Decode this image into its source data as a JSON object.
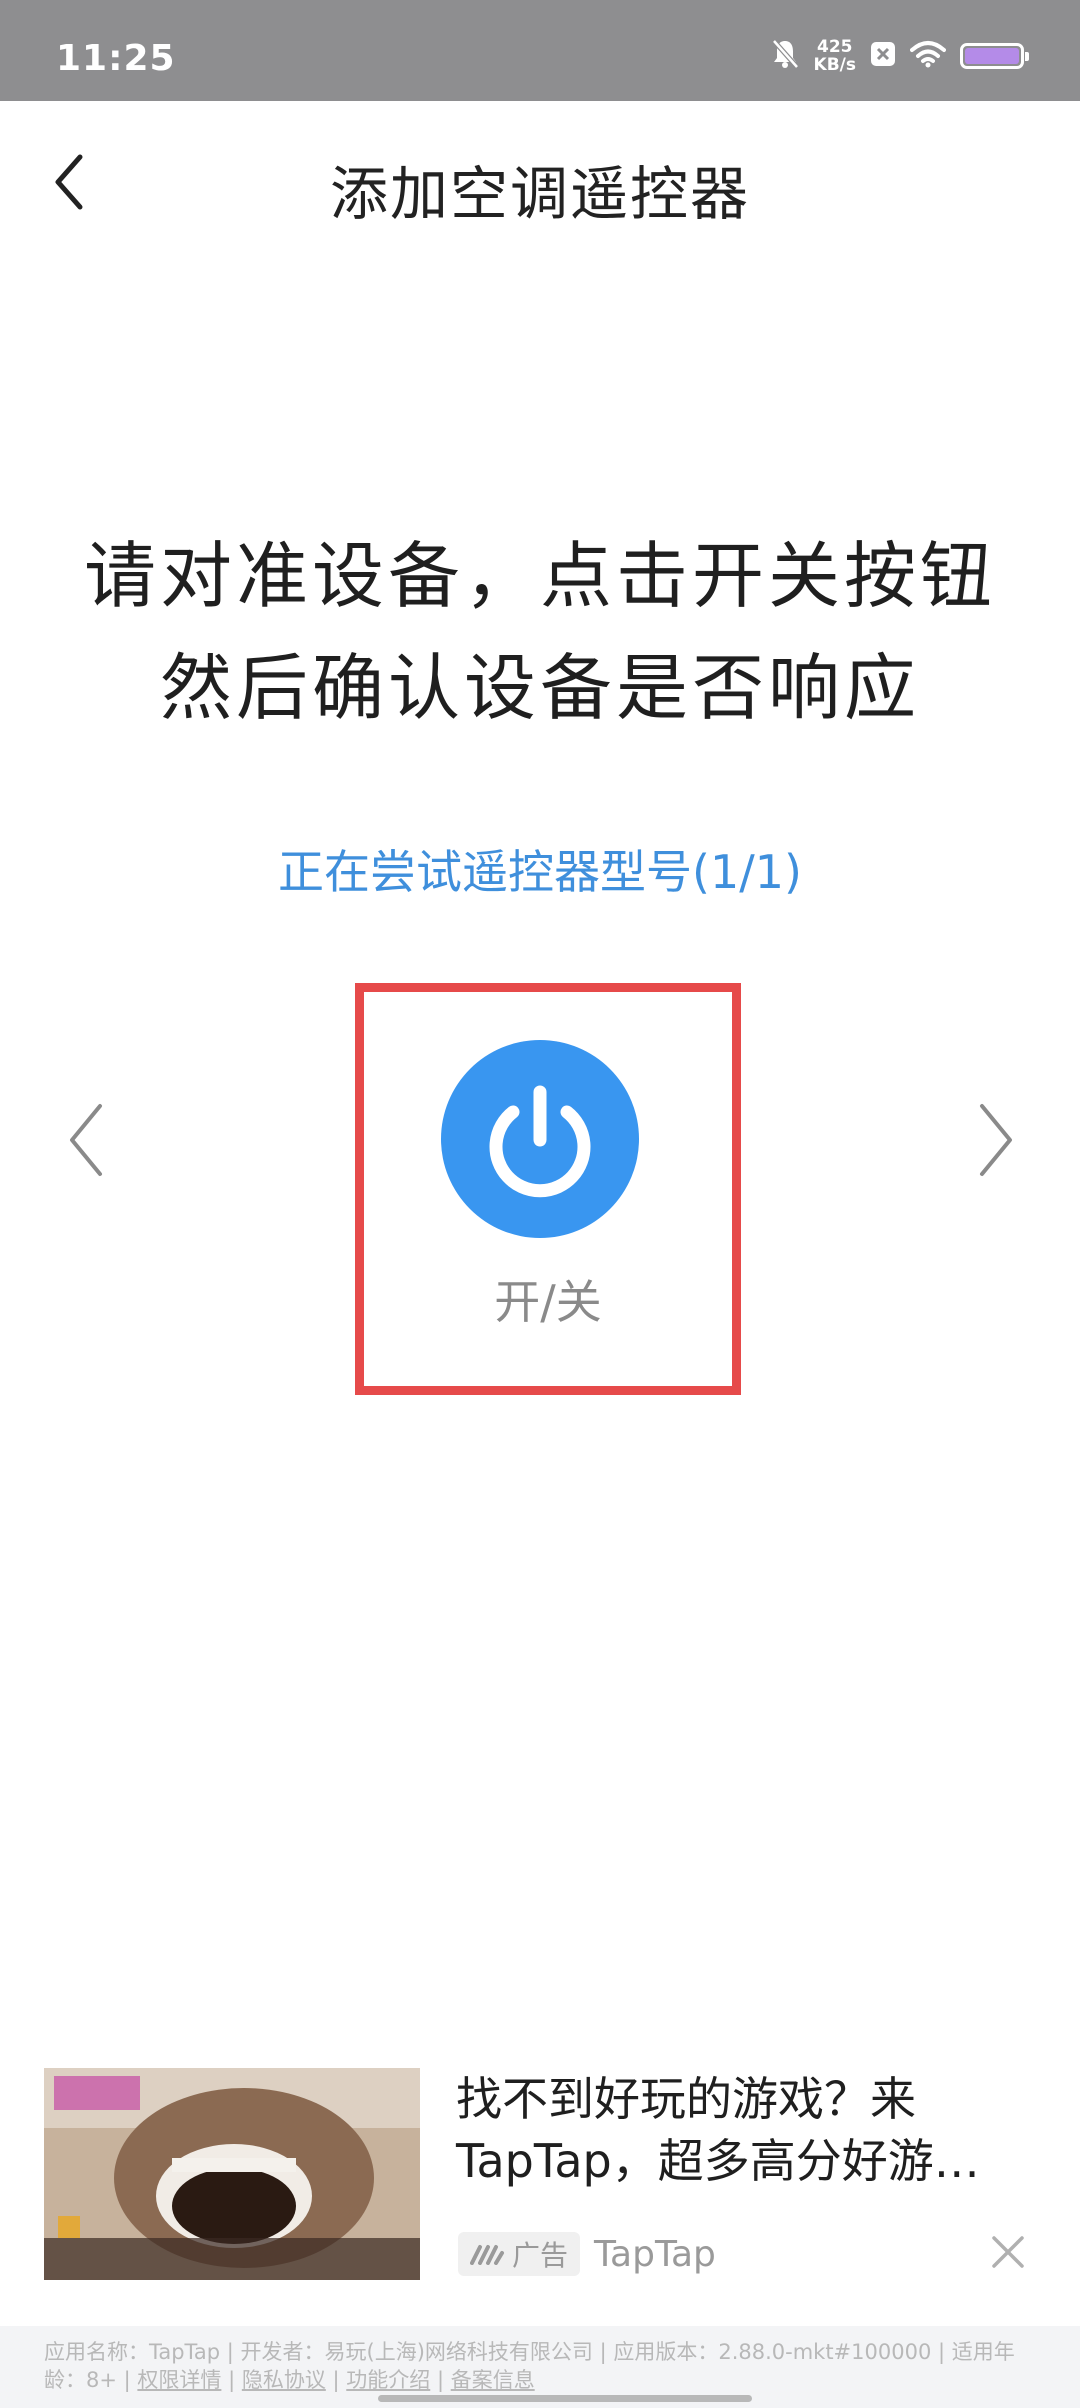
{
  "status_bar": {
    "time": "11:25",
    "net_speed_value": "425",
    "net_speed_unit": "KB/s",
    "icons": [
      "bell-off-icon",
      "close-box-icon",
      "wifi-icon",
      "battery-icon"
    ]
  },
  "header": {
    "title": "添加空调遥控器"
  },
  "instruction": {
    "line1": "请对准设备，点击开关按钮",
    "line2": "然后确认设备是否响应"
  },
  "status": {
    "trying_text": "正在尝试遥控器型号(1/1)"
  },
  "remote": {
    "power_label": "开/关"
  },
  "ad": {
    "title": "找不到好玩的游戏？来TapTap，超多高分好游…",
    "badge": "广告",
    "source": "TapTap"
  },
  "app_info": {
    "text": "应用名称：TapTap | 开发者：易玩(上海)网络科技有限公司 | 应用版本：2.88.0-mkt#100000 | 适用年龄：8+ | ",
    "link1": "权限详情",
    "sep1": " | ",
    "link2": "隐私协议",
    "sep2": " | ",
    "link3": "功能介绍",
    "sep3": " | ",
    "link4": "备案信息"
  },
  "colors": {
    "accent_blue": "#3996f0",
    "highlight_red": "#e64a4a",
    "status_bar_gray": "#8e8e90"
  }
}
